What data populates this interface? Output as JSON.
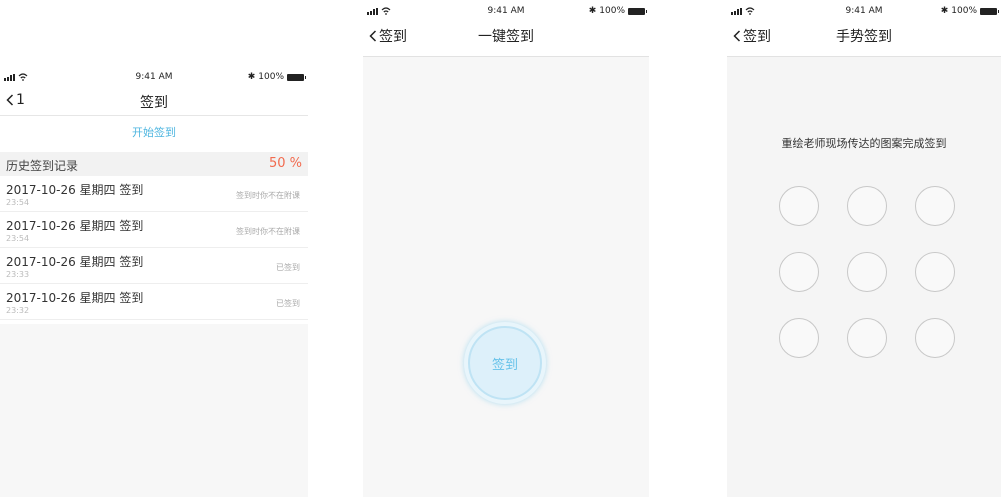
{
  "screen1": {
    "status": {
      "time": "9:41 AM",
      "battery": "100%"
    },
    "nav": {
      "back_label": "1",
      "title": "签到"
    },
    "start_button": "开始签到",
    "history": {
      "label": "历史签到记录",
      "percent": "50 %",
      "records": [
        {
          "title": "2017-10-26 星期四 签到",
          "time": "23:54",
          "status": "签到时你不在附课"
        },
        {
          "title": "2017-10-26 星期四 签到",
          "time": "23:54",
          "status": "签到时你不在附课"
        },
        {
          "title": "2017-10-26 星期四 签到",
          "time": "23:33",
          "status": "已签到"
        },
        {
          "title": "2017-10-26 星期四 签到",
          "time": "23:32",
          "status": "已签到"
        }
      ]
    }
  },
  "screen2": {
    "status": {
      "time": "9:41 AM",
      "battery": "100%"
    },
    "nav": {
      "back_label": "签到",
      "title": "一键签到"
    },
    "checkin_button": "签到"
  },
  "screen3": {
    "status": {
      "time": "9:41 AM",
      "battery": "100%"
    },
    "nav": {
      "back_label": "签到",
      "title": "手势签到"
    },
    "prompt": "重绘老师现场传达的图案完成签到",
    "pattern_dots": 9
  },
  "colors": {
    "accent_blue": "#4fb6e0",
    "percent_red": "#f26b4f"
  }
}
